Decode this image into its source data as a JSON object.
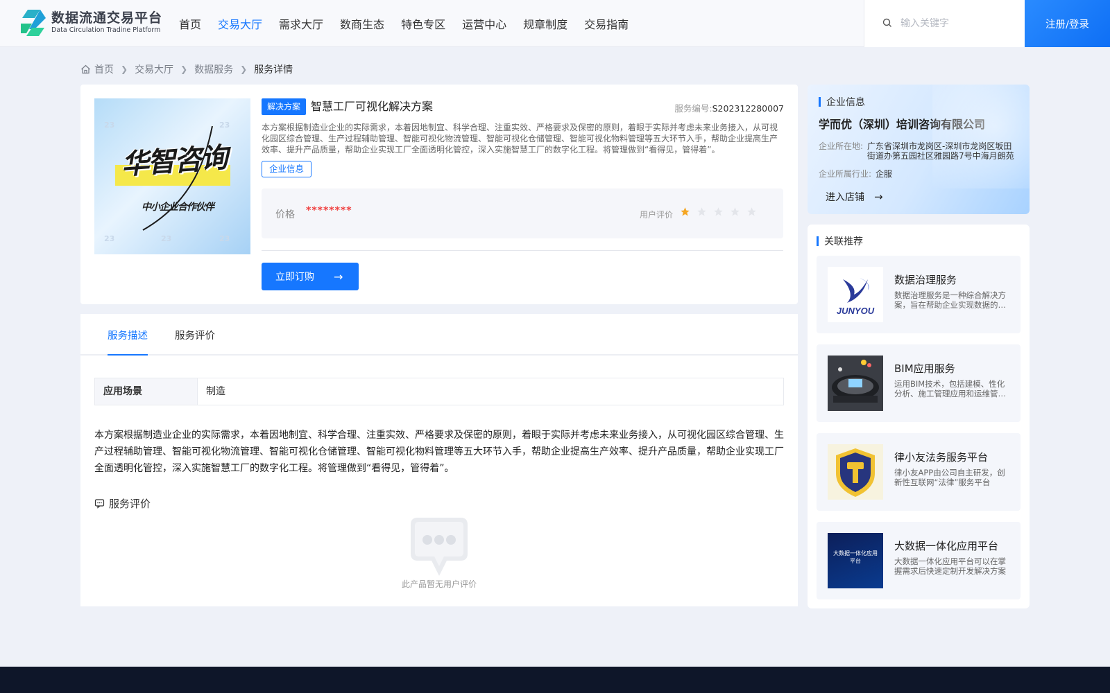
{
  "header": {
    "logo_title": "数据流通交易平台",
    "logo_subtitle": "Data Circulation Tradine Platform",
    "nav": [
      {
        "label": "首页",
        "active": false
      },
      {
        "label": "交易大厅",
        "active": true
      },
      {
        "label": "需求大厅",
        "active": false
      },
      {
        "label": "数商生态",
        "active": false
      },
      {
        "label": "特色专区",
        "active": false
      },
      {
        "label": "运营中心",
        "active": false
      },
      {
        "label": "规章制度",
        "active": false
      },
      {
        "label": "交易指南",
        "active": false
      }
    ],
    "search_placeholder": "输入关键字",
    "login_label": "注册/登录"
  },
  "breadcrumb": [
    "首页",
    "交易大厅",
    "数据服务",
    "服务详情"
  ],
  "product": {
    "image_title": "华智咨询",
    "image_subtitle": "中小企业合作伙伴",
    "tag": "解决方案",
    "title": "智慧工厂可视化解决方案",
    "service_no_label": "服务编号:",
    "service_no": "S202312280007",
    "description": "本方案根据制造业企业的实际需求，本着因地制宜、科学合理、注重实效、严格要求及保密的原则，着眼于实际并考虑未来业务接入，从可视化园区综合管理、生产过程辅助管理、智能可视化物流管理、智能可视化仓储管理、智能可视化物料管理等五大环节入手，帮助企业提高生产效率、提升产品质量，帮助企业实现工厂全面透明化管控，深入实施智慧工厂的数字化工程。将管理做到“看得见，管得着”。",
    "company_tag": "企业信息",
    "price_label": "价格",
    "price_value": "********",
    "rating_label": "用户评价",
    "rating": 1,
    "rating_max": 5,
    "buy_label": "立即订购"
  },
  "tabs": [
    {
      "label": "服务描述",
      "active": true
    },
    {
      "label": "服务评价",
      "active": false
    }
  ],
  "scene": {
    "key": "应用场景",
    "value": "制造"
  },
  "detail_text": "本方案根据制造业企业的实际需求，本着因地制宜、科学合理、注重实效、严格要求及保密的原则，着眼于实际并考虑未来业务接入，从可视化园区综合管理、生产过程辅助管理、智能可视化物流管理、智能可视化仓储管理、智能可视化物料管理等五大环节入手，帮助企业提高生产效率、提升产品质量，帮助企业实现工厂全面透明化管控，深入实施智慧工厂的数字化工程。将管理做到“看得见，管得着”。",
  "reviews": {
    "heading": "服务评价",
    "empty_text": "此产品暂无用户评价"
  },
  "company": {
    "heading": "企业信息",
    "name": "学而优（深圳）培训咨询有限公司",
    "location_label": "企业所在地:",
    "location": "广东省深圳市龙岗区-深圳市龙岗区坂田街道办第五园社区雅园路7号中海月朗苑",
    "industry_label": "企业所属行业:",
    "industry": "企服",
    "enter_shop": "进入店铺"
  },
  "recommend": {
    "heading": "关联推荐",
    "items": [
      {
        "title": "数据治理服务",
        "desc": "数据治理服务是一种综合解决方案，旨在帮助企业实现数据的规范化管理",
        "thumb_text": "JUNYOU"
      },
      {
        "title": "BIM应用服务",
        "desc": "运用BIM技术，包括建模、性化分析、施工管理应用和运维管理等服务",
        "thumb_text": ""
      },
      {
        "title": "律小友法务服务平台",
        "desc": "律小友APP由公司自主研发，创新性互联网“法律”服务平台",
        "thumb_text": ""
      },
      {
        "title": "大数据一体化应用平台",
        "desc": "大数据一体化应用平台可以在掌握需求后快速定制开发解决方案",
        "thumb_text": "大数据一体化应用平台"
      }
    ]
  },
  "colors": {
    "primary": "#1677ff",
    "price": "#f04040",
    "star_active": "#f5a623",
    "star_inactive": "#e3e5ea",
    "footer": "#0e1629"
  }
}
